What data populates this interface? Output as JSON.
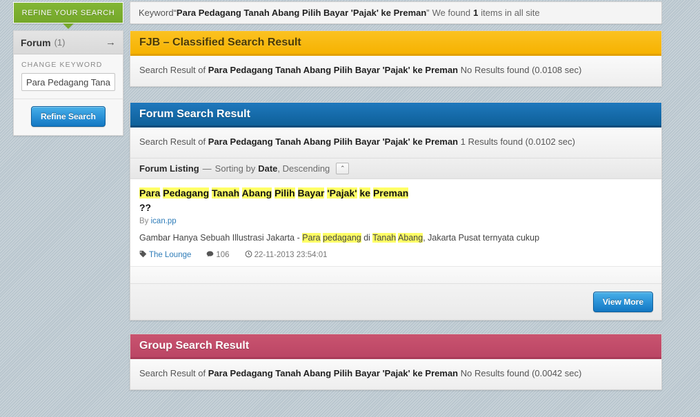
{
  "keyword_bar": {
    "prefix": "Keyword",
    "open_quote": "“",
    "term": "Para Pedagang Tanah Abang Pilih Bayar 'Pajak' ke Preman",
    "close_quote": "”",
    "found_prefix": "We found",
    "count": "1",
    "found_suffix": "items in all site"
  },
  "sidebar": {
    "tab_label": "REFINE YOUR SEARCH",
    "facet": {
      "label": "Forum",
      "count": "(1)",
      "arrow_icon": "→"
    },
    "change_keyword_label": "CHANGE KEYWORD",
    "keyword_input_value": "Para Pedagang Tanah",
    "keyword_input_placeholder": "Keyword",
    "refine_button_label": "Refine Search"
  },
  "panels": {
    "fjb": {
      "title": "FJB – Classified Search Result",
      "accent_color": "#f6b200",
      "summary_prefix": "Search Result of",
      "summary_term": "Para Pedagang Tanah Abang Pilih Bayar 'Pajak' ke Preman",
      "summary_suffix": "No Results found (0.0108 sec)"
    },
    "forum": {
      "title": "Forum Search Result",
      "accent_color": "#0e6099",
      "summary_prefix": "Search Result of",
      "summary_term": "Para Pedagang Tanah Abang Pilih Bayar 'Pajak' ke Preman",
      "summary_suffix": "1 Results found (0.0102 sec)",
      "listing": {
        "heading": "Forum Listing",
        "dash": "—",
        "sorting_prefix": "Sorting by",
        "sort_field": "Date",
        "sort_direction": ", Descending",
        "collapse_icon": "⌃"
      },
      "results": [
        {
          "title_parts": [
            {
              "text": "Para",
              "highlight": true
            },
            {
              "text": " ",
              "highlight": false
            },
            {
              "text": "Pedagang",
              "highlight": true
            },
            {
              "text": " ",
              "highlight": false
            },
            {
              "text": "Tanah",
              "highlight": true
            },
            {
              "text": " ",
              "highlight": false
            },
            {
              "text": "Abang",
              "highlight": true
            },
            {
              "text": " ",
              "highlight": false
            },
            {
              "text": "Pilih",
              "highlight": true
            },
            {
              "text": " ",
              "highlight": false
            },
            {
              "text": "Bayar",
              "highlight": true
            },
            {
              "text": " ",
              "highlight": false
            },
            {
              "text": "'Pajak'",
              "highlight": true
            },
            {
              "text": " ",
              "highlight": false
            },
            {
              "text": "ke",
              "highlight": true
            },
            {
              "text": " ",
              "highlight": false
            },
            {
              "text": "Preman",
              "highlight": true
            },
            {
              "text": " ??",
              "highlight": false
            }
          ],
          "by_prefix": "By",
          "author": "ican.pp",
          "snippet_parts": [
            {
              "text": "Gambar Hanya Sebuah Illustrasi Jakarta - ",
              "highlight": false
            },
            {
              "text": "Para",
              "highlight": true
            },
            {
              "text": " ",
              "highlight": false
            },
            {
              "text": "pedagang",
              "highlight": true
            },
            {
              "text": " di ",
              "highlight": false
            },
            {
              "text": "Tanah",
              "highlight": true
            },
            {
              "text": " ",
              "highlight": false
            },
            {
              "text": "Abang",
              "highlight": true
            },
            {
              "text": ", Jakarta Pusat ternyata cukup",
              "highlight": false
            }
          ],
          "forum_name": "The Lounge",
          "tag_icon": "tag-icon",
          "comment_icon": "comment-icon",
          "comment_count": "106",
          "clock_icon": "clock-icon",
          "timestamp": "22-11-2013 23:54:01"
        }
      ],
      "view_more_label": "View More"
    },
    "group": {
      "title": "Group Search Result",
      "accent_color": "#bb4665",
      "summary_prefix": "Search Result of",
      "summary_term": "Para Pedagang Tanah Abang Pilih Bayar 'Pajak' ke Preman",
      "summary_suffix": "No Results found (0.0042 sec)"
    }
  }
}
